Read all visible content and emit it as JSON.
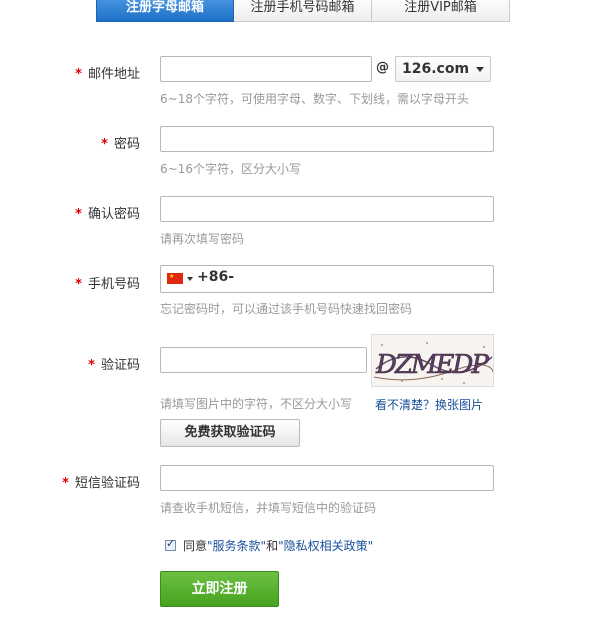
{
  "tabs": [
    {
      "label": "注册字母邮箱",
      "active": true
    },
    {
      "label": "注册手机号码邮箱",
      "active": false
    },
    {
      "label": "注册VIP邮箱",
      "active": false
    }
  ],
  "form": {
    "email": {
      "required_mark": "*",
      "label": "邮件地址",
      "value": "",
      "at": "@",
      "domain": "126.com",
      "hint": "6~18个字符，可使用字母、数字、下划线，需以字母开头"
    },
    "password": {
      "required_mark": "*",
      "label": "密码",
      "value": "",
      "hint": "6~16个字符，区分大小写"
    },
    "confirm_password": {
      "required_mark": "*",
      "label": "确认密码",
      "value": "",
      "hint": "请再次填写密码"
    },
    "phone": {
      "required_mark": "*",
      "label": "手机号码",
      "country_code": "+86-",
      "value": "",
      "hint": "忘记密码时，可以通过该手机号码快速找回密码"
    },
    "captcha": {
      "required_mark": "*",
      "label": "验证码",
      "value": "",
      "image_text": "DZMEDP",
      "refresh_link": "看不清楚？换张图片",
      "hint": "请填写图片中的字符，不区分大小写",
      "get_code_button": "免费获取验证码"
    },
    "sms_code": {
      "required_mark": "*",
      "label": "短信验证码",
      "value": "",
      "hint": "请查收手机短信，并填写短信中的验证码"
    },
    "agree": {
      "checked": true,
      "prefix": "同意",
      "terms": "\"服务条款\"",
      "and": "和",
      "privacy": "\"隐私权相关政策\""
    },
    "submit_label": "立即注册"
  },
  "colors": {
    "accent_blue": "#1d6fc8",
    "required_red": "#dd0000",
    "submit_green": "#48a21f",
    "link_blue": "#1a4f9a"
  }
}
